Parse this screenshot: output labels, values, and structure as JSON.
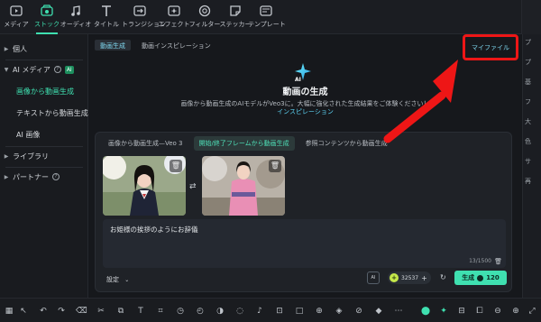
{
  "toolbar": {
    "items": [
      {
        "label": "メディア",
        "icon": "media-icon"
      },
      {
        "label": "ストック",
        "icon": "stock-icon"
      },
      {
        "label": "オーディオ",
        "icon": "music-note-icon"
      },
      {
        "label": "タイトル",
        "icon": "title-icon"
      },
      {
        "label": "トランジション",
        "icon": "transition-icon"
      },
      {
        "label": "エフェクト",
        "icon": "effect-icon"
      },
      {
        "label": "フィルター",
        "icon": "filter-icon"
      },
      {
        "label": "ステッカー",
        "icon": "sticker-icon"
      },
      {
        "label": "テンプレート",
        "icon": "template-icon"
      }
    ],
    "active": "ストック"
  },
  "sidebar": {
    "personal": "個人",
    "ai_media": "AI メディア",
    "ai_badge": "AI",
    "items": [
      "画像から動画生成",
      "テキストから動画生成",
      "AI 画像"
    ],
    "library": "ライブラリ",
    "partner": "パートナー"
  },
  "main": {
    "tabs": [
      "動画生成",
      "動画インスピレーション"
    ],
    "my_files": "マイファイル",
    "hero_icon_text": "AI",
    "title": "動画の生成",
    "description": "画像から動画生成のAIモデルがVeo3に。大幅に強化された生成結果をご体験ください！",
    "link": "インスピレーション",
    "modes": [
      "画像から動画生成—Veo 3",
      "開始/終了フレームから動画生成",
      "参照コンテンツから動画生成"
    ],
    "prompt": "お姫様の挨拶のようにお辞儀",
    "counter": "13/1500",
    "settings": "設定",
    "ai_button_text": "AI",
    "credits": "32537",
    "generate": "生成",
    "generate_cost": "120"
  },
  "right_panel": [
    "プ",
    "プ",
    "基",
    "フ",
    "大",
    "色",
    "サ",
    "再"
  ],
  "colors": {
    "accent": "#3fe0b0",
    "highlight": "#ee1616",
    "link": "#5cd0f0"
  }
}
